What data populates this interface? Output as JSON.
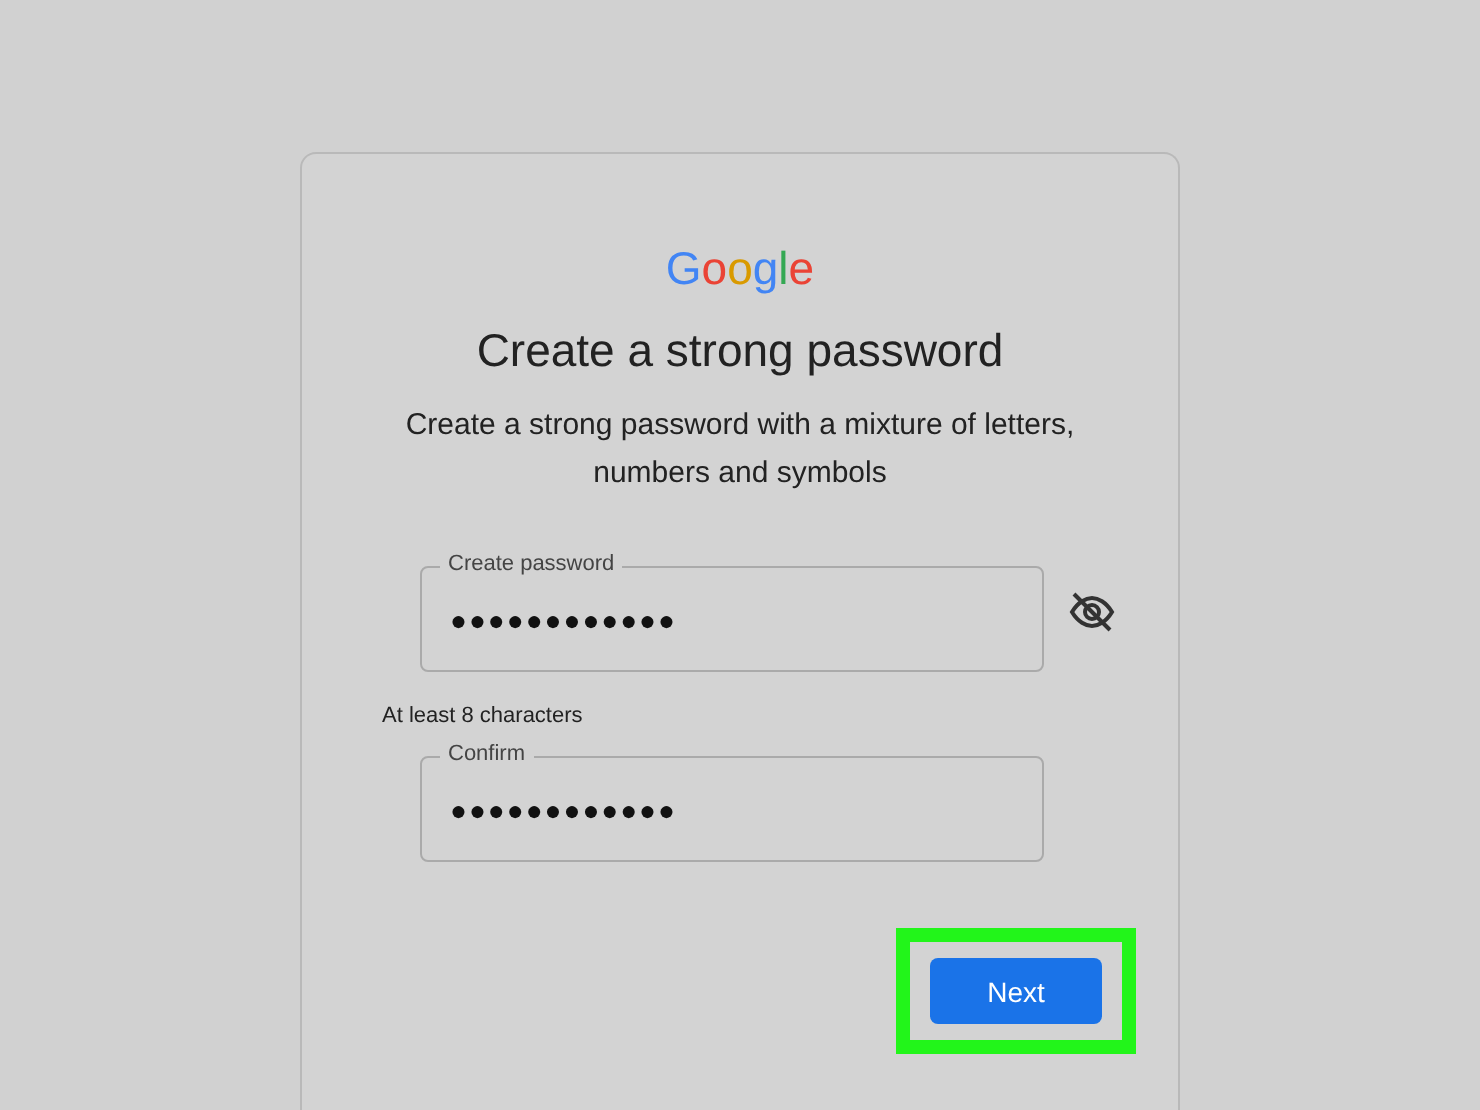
{
  "logo": [
    {
      "letter": "G",
      "color": "#4285f4"
    },
    {
      "letter": "o",
      "color": "#ea4335"
    },
    {
      "letter": "o",
      "color": "#d99a00"
    },
    {
      "letter": "g",
      "color": "#4285f4"
    },
    {
      "letter": "l",
      "color": "#34a853"
    },
    {
      "letter": "e",
      "color": "#ea4335"
    }
  ],
  "title": "Create a strong password",
  "subtitle": "Create a strong password with a mixture of letters, numbers and symbols",
  "fields": [
    {
      "label": "Create password",
      "value": "●●●●●●●●●●●●",
      "hint": "At least 8 characters",
      "show_toggle": true
    },
    {
      "label": "Confirm",
      "value": "●●●●●●●●●●●●",
      "show_toggle": false
    }
  ],
  "next_button": {
    "label": "Next",
    "highlighted": true
  }
}
